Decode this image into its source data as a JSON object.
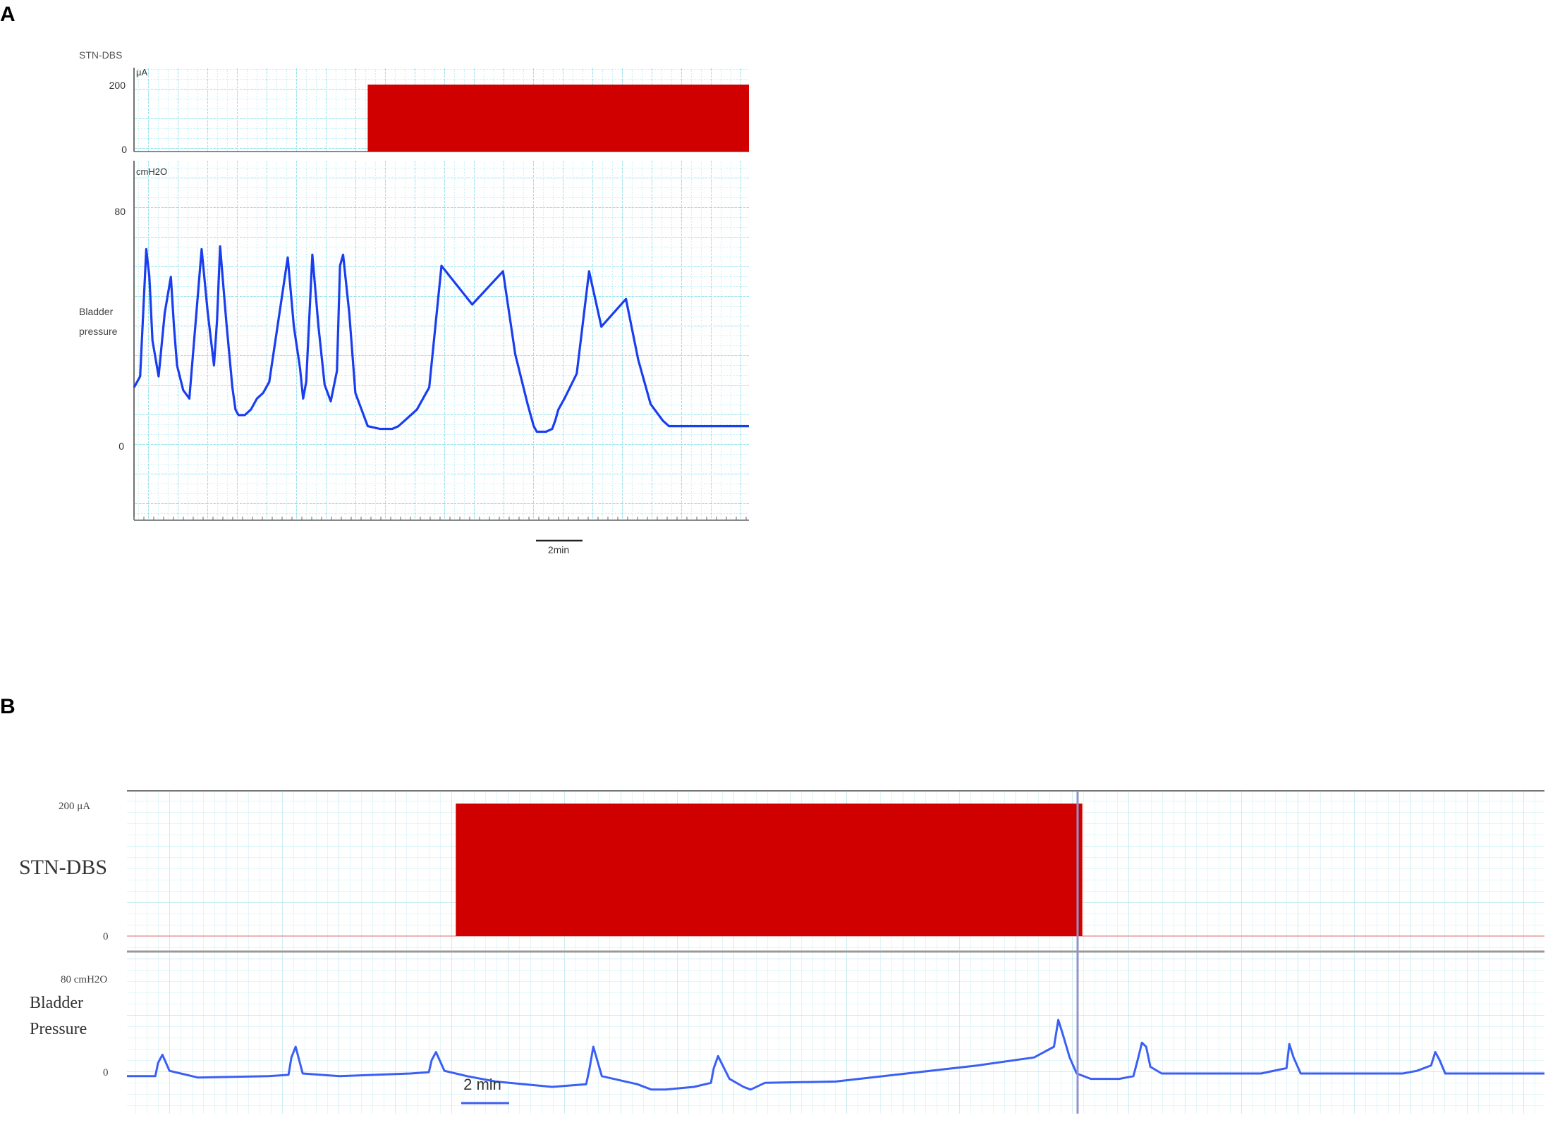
{
  "chart_data": [
    {
      "panel": "A",
      "type": "line",
      "stim": {
        "label": "STN-DBS",
        "unit": "μA",
        "ylim": [
          0,
          200
        ],
        "yticks": [
          0,
          200
        ],
        "on_from": 0.38,
        "on_to": 1.0,
        "level": 200
      },
      "pressure": {
        "label_lines": [
          "Bladder",
          "pressure"
        ],
        "unit": "cmH2O",
        "ylim": [
          -30,
          100
        ],
        "yticks": [
          0,
          80
        ],
        "x": [
          0,
          0.01,
          0.02,
          0.025,
          0.03,
          0.04,
          0.05,
          0.06,
          0.065,
          0.07,
          0.08,
          0.09,
          0.11,
          0.12,
          0.13,
          0.135,
          0.14,
          0.15,
          0.16,
          0.165,
          0.17,
          0.18,
          0.19,
          0.2,
          0.21,
          0.22,
          0.25,
          0.26,
          0.27,
          0.275,
          0.28,
          0.29,
          0.3,
          0.31,
          0.32,
          0.33,
          0.335,
          0.34,
          0.35,
          0.36,
          0.38,
          0.4,
          0.405,
          0.41,
          0.415,
          0.42,
          0.43,
          0.44,
          0.46,
          0.48,
          0.5,
          0.55,
          0.6,
          0.62,
          0.64,
          0.65,
          0.655,
          0.66,
          0.67,
          0.68,
          0.685,
          0.69,
          0.7,
          0.72,
          0.74,
          0.76,
          0.8,
          0.82,
          0.84,
          0.86,
          0.87,
          0.875,
          0.88,
          0.89,
          0.9,
          0.905,
          0.91,
          0.92,
          0.94,
          0.97,
          1.0
        ],
        "y": [
          18,
          22,
          68,
          58,
          35,
          22,
          45,
          58,
          40,
          26,
          17,
          14,
          68,
          45,
          26,
          42,
          69,
          42,
          18,
          10,
          8,
          8,
          10,
          14,
          16,
          20,
          65,
          40,
          25,
          14,
          20,
          66,
          40,
          19,
          13,
          24,
          62,
          66,
          45,
          16,
          4,
          3,
          3,
          3,
          3,
          3,
          4,
          6,
          10,
          18,
          62,
          48,
          60,
          30,
          12,
          4,
          2,
          2,
          2,
          3,
          6,
          10,
          14,
          23,
          60,
          40,
          50,
          28,
          12,
          6,
          4,
          4,
          4,
          4,
          4,
          4,
          4,
          4,
          4,
          4,
          4
        ],
        "trace_color": "#1a3df0"
      },
      "scale_bar": "2min",
      "stim_color": "#d10000"
    },
    {
      "panel": "B",
      "type": "line",
      "stim": {
        "label": "STN-DBS",
        "tick_top": "200 μA",
        "tick_bottom": "0",
        "ylim": [
          0,
          200
        ],
        "on_from": 0.232,
        "on_to": 0.674,
        "level": 200
      },
      "pressure": {
        "label_lines": [
          "Bladder",
          "Pressure"
        ],
        "tick_top": "80 cmH2O",
        "tick_bottom": "0",
        "ylim": [
          -20,
          100
        ],
        "x": [
          0,
          0.02,
          0.022,
          0.025,
          0.03,
          0.05,
          0.1,
          0.114,
          0.116,
          0.119,
          0.124,
          0.15,
          0.2,
          0.213,
          0.215,
          0.218,
          0.224,
          0.24,
          0.26,
          0.3,
          0.324,
          0.326,
          0.329,
          0.335,
          0.36,
          0.37,
          0.38,
          0.4,
          0.412,
          0.414,
          0.417,
          0.425,
          0.435,
          0.44,
          0.45,
          0.5,
          0.55,
          0.6,
          0.64,
          0.654,
          0.657,
          0.66,
          0.665,
          0.67,
          0.68,
          0.7,
          0.71,
          0.713,
          0.716,
          0.719,
          0.722,
          0.73,
          0.75,
          0.78,
          0.8,
          0.818,
          0.82,
          0.823,
          0.828,
          0.85,
          0.9,
          0.91,
          0.92,
          0.923,
          0.926,
          0.93,
          0.95,
          1.0
        ],
        "y": [
          8,
          8,
          18,
          24,
          12,
          7,
          8,
          9,
          22,
          30,
          10,
          8,
          10,
          11,
          20,
          26,
          12,
          8,
          4,
          0,
          2,
          12,
          30,
          8,
          2,
          -2,
          -2,
          0,
          3,
          14,
          23,
          6,
          0,
          -2,
          3,
          4,
          10,
          16,
          22,
          30,
          50,
          40,
          22,
          10,
          6,
          6,
          8,
          20,
          33,
          30,
          15,
          10,
          10,
          10,
          10,
          14,
          32,
          22,
          10,
          10,
          10,
          12,
          16,
          26,
          20,
          10,
          10,
          10
        ],
        "trace_color": "#3a5ff5"
      },
      "scale_bar": "2 min",
      "stim_color": "#d10000"
    }
  ],
  "labels": {
    "panel_a": "A",
    "panel_b": "B"
  }
}
